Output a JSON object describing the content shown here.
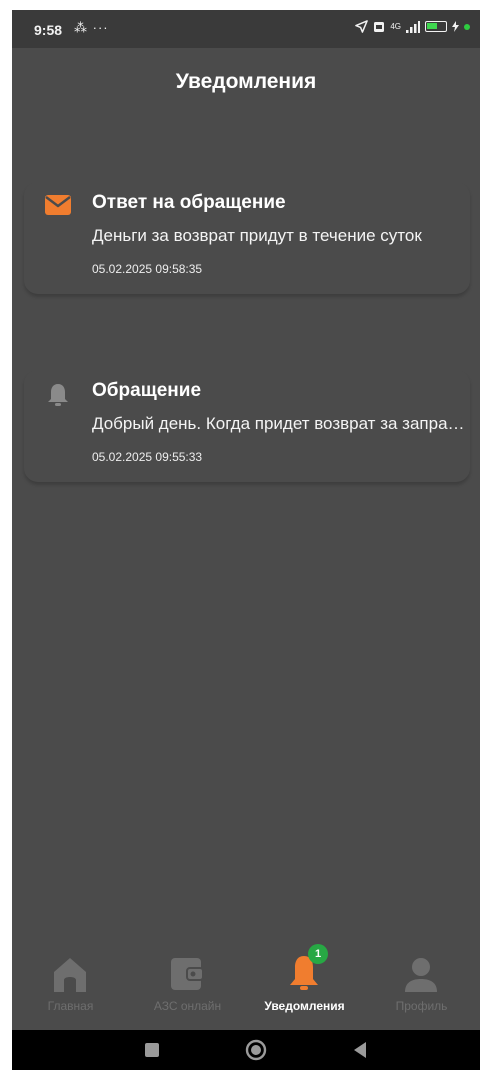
{
  "status_bar": {
    "time": "9:58",
    "left_icons": "⁂ ···",
    "network_label": "4G",
    "battery_level": 0.6,
    "icons": [
      "location-arrow-icon",
      "sim-icon",
      "signal-icon",
      "battery-icon",
      "charging-dot-icon"
    ]
  },
  "header": {
    "title": "Уведомления"
  },
  "notifications": [
    {
      "icon": "envelope-icon",
      "icon_color": "#f07d2f",
      "title": "Ответ на обращение",
      "body": "Деньги за возврат придут в течение суток",
      "timestamp": "05.02.2025 09:58:35"
    },
    {
      "icon": "bell-icon",
      "icon_color": "#8a8a8a",
      "title": "Обращение",
      "body": "Добрый день. Когда придет возврат за заправку?",
      "timestamp": "05.02.2025 09:55:33"
    }
  ],
  "bottom_nav": {
    "items": [
      {
        "label": "Главная",
        "icon": "home-icon",
        "active": false
      },
      {
        "label": "АЗС онлайн",
        "icon": "wallet-icon",
        "active": false
      },
      {
        "label": "Уведомления",
        "icon": "bell-icon",
        "active": true,
        "badge": "1"
      },
      {
        "label": "Профиль",
        "icon": "profile-icon",
        "active": false
      }
    ]
  },
  "colors": {
    "background": "#4b4b4b",
    "accent": "#f07d2f",
    "badge": "#27a844",
    "inactive": "#6e6e6e"
  },
  "system_nav": {
    "icons": [
      "square-icon",
      "circle-icon",
      "back-triangle-icon"
    ]
  }
}
